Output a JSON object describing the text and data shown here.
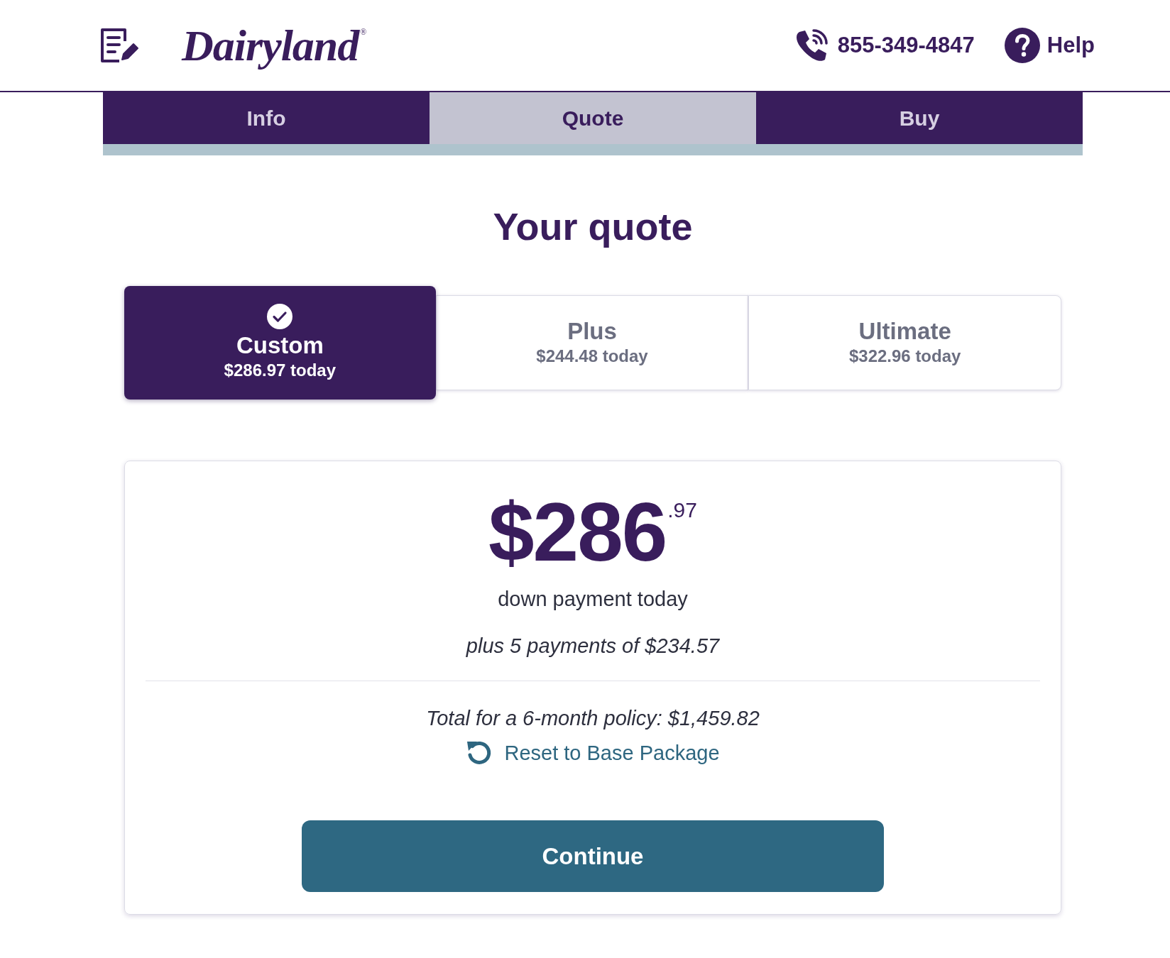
{
  "header": {
    "logo": {
      "text": "Dairyland",
      "mark": "®"
    },
    "phone": "855-349-4847",
    "help": "Help"
  },
  "steps": [
    {
      "label": "Info",
      "selected": false
    },
    {
      "label": "Quote",
      "selected": true
    },
    {
      "label": "Buy",
      "selected": false
    }
  ],
  "title": "Your quote",
  "packages": [
    {
      "name": "Custom",
      "price": "$286.97 today",
      "selected": true
    },
    {
      "name": "Plus",
      "price": "$244.48 today",
      "selected": false
    },
    {
      "name": "Ultimate",
      "price": "$322.96 today",
      "selected": false
    }
  ],
  "summary": {
    "amount": "$286",
    "cents": ".97",
    "amount_caption": "down payment today",
    "installments": "plus 5 payments of $234.57",
    "total": "Total for a 6-month policy: $1,459.82",
    "reset_link": "Reset to Base Package",
    "continue_button": "Continue"
  }
}
